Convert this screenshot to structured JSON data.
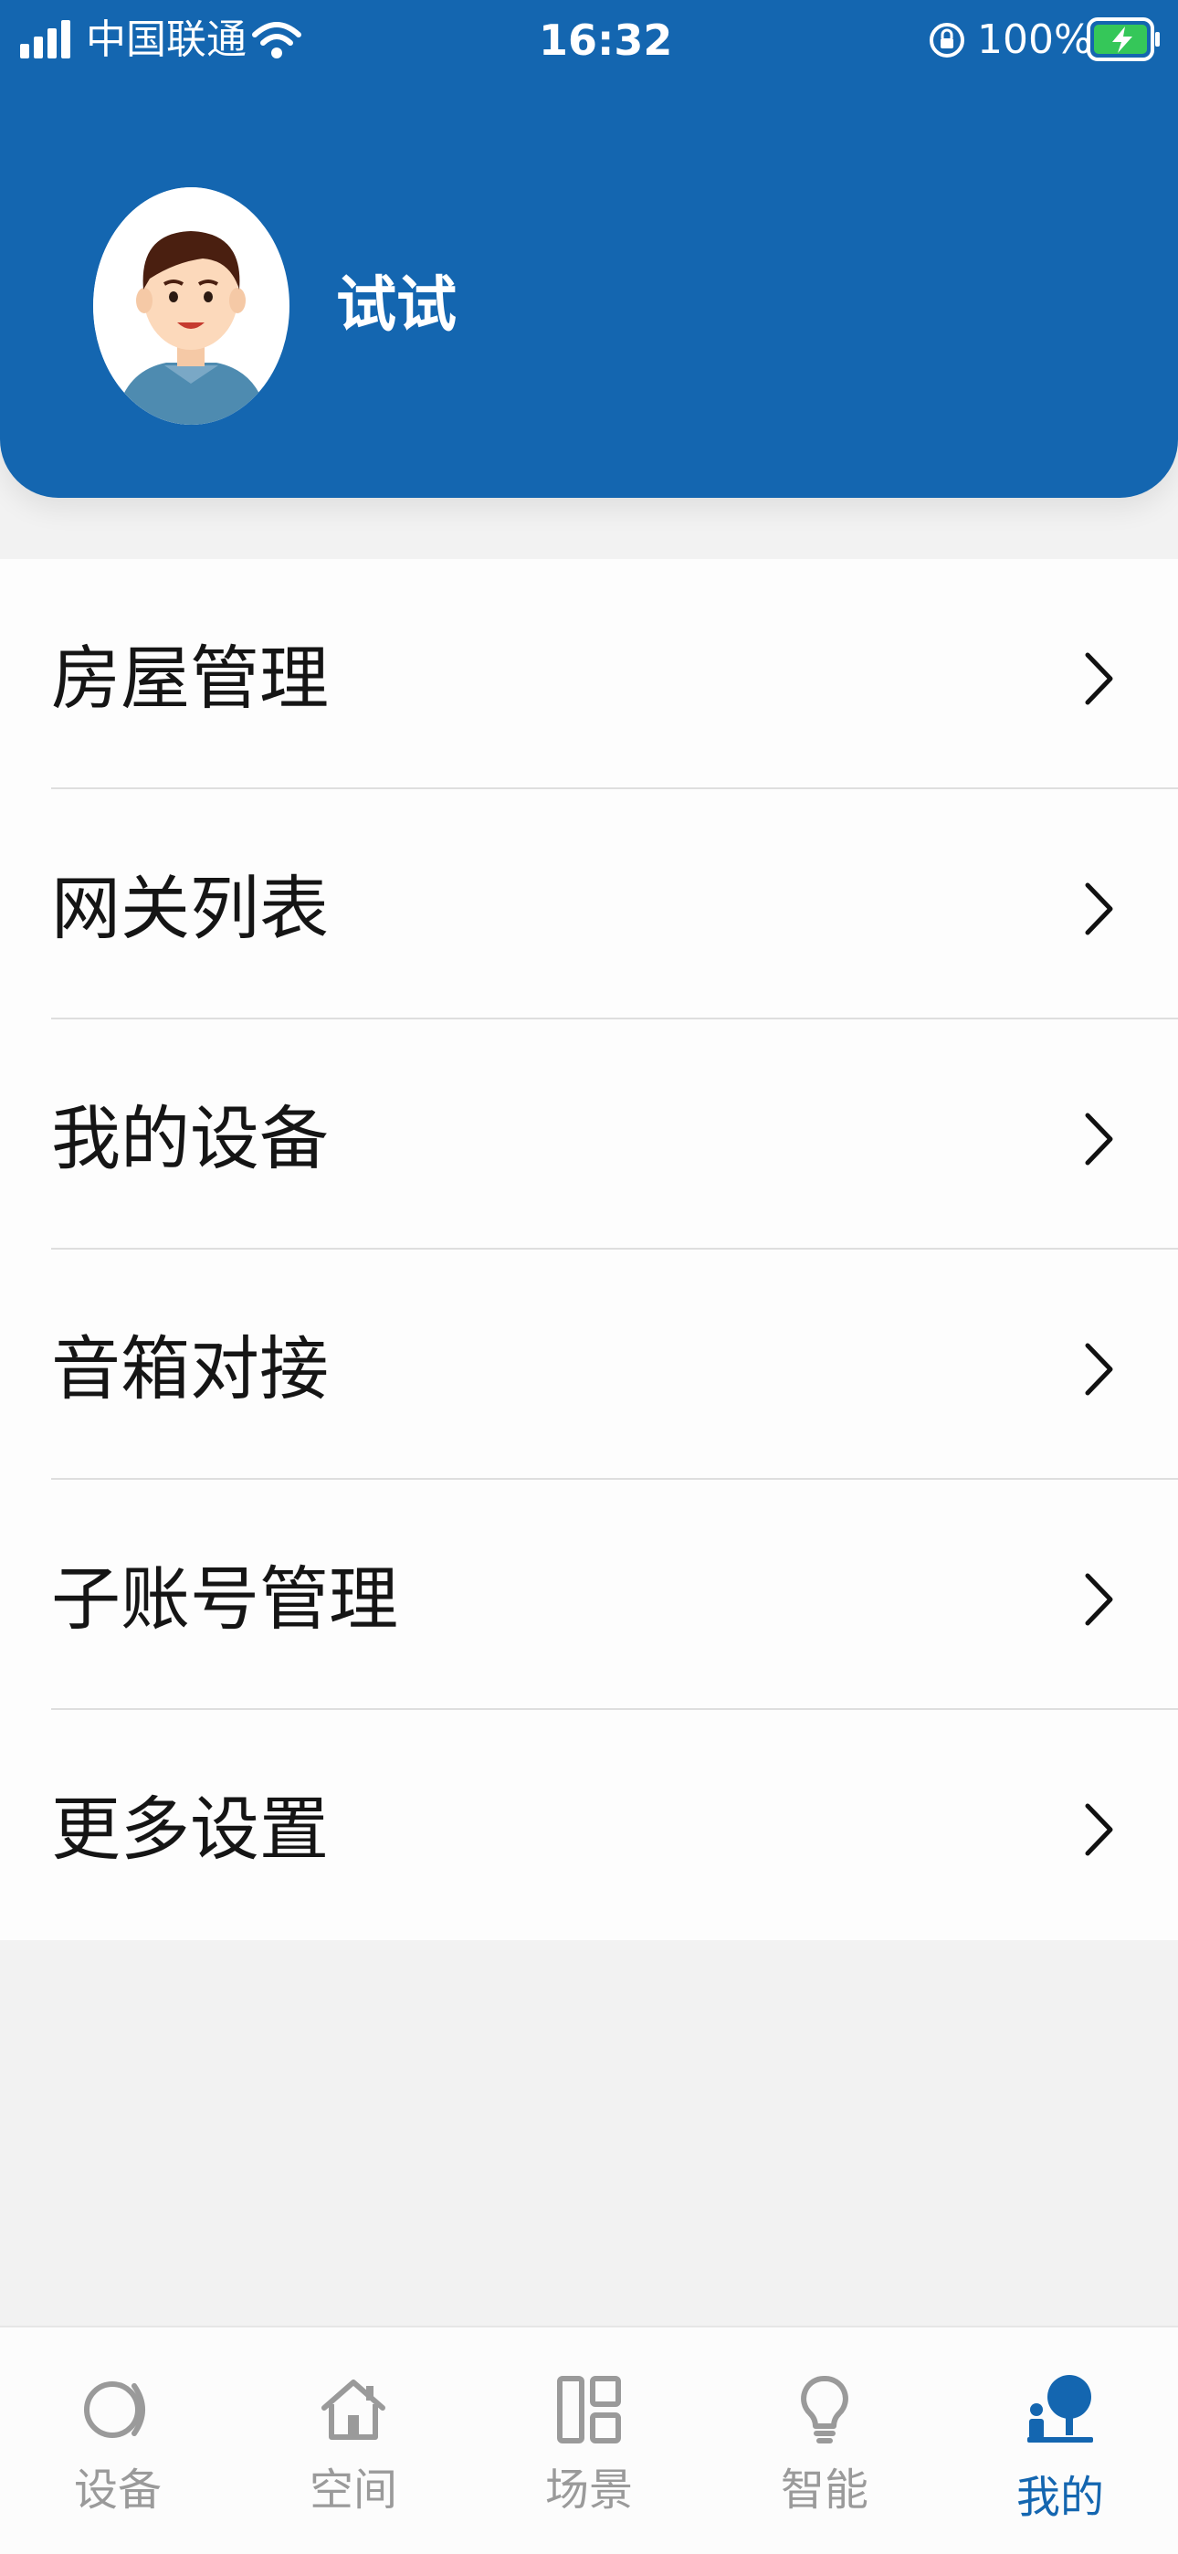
{
  "status_bar": {
    "carrier": "中国联通",
    "time": "16:32",
    "battery": "100%"
  },
  "profile": {
    "username": "试试"
  },
  "menu": {
    "items": [
      {
        "label": "房屋管理"
      },
      {
        "label": "网关列表"
      },
      {
        "label": "我的设备"
      },
      {
        "label": "音箱对接"
      },
      {
        "label": "子账号管理"
      },
      {
        "label": "更多设置"
      }
    ]
  },
  "tabbar": {
    "tabs": [
      {
        "label": "设备",
        "icon": "device-icon"
      },
      {
        "label": "空间",
        "icon": "home-icon"
      },
      {
        "label": "场景",
        "icon": "scene-icon"
      },
      {
        "label": "智能",
        "icon": "bulb-icon"
      },
      {
        "label": "我的",
        "icon": "profile-icon"
      }
    ],
    "active": "我的"
  },
  "colors": {
    "primary": "#1466b0",
    "background": "#f2f2f2",
    "inactive_tab": "#9a9a9a"
  }
}
